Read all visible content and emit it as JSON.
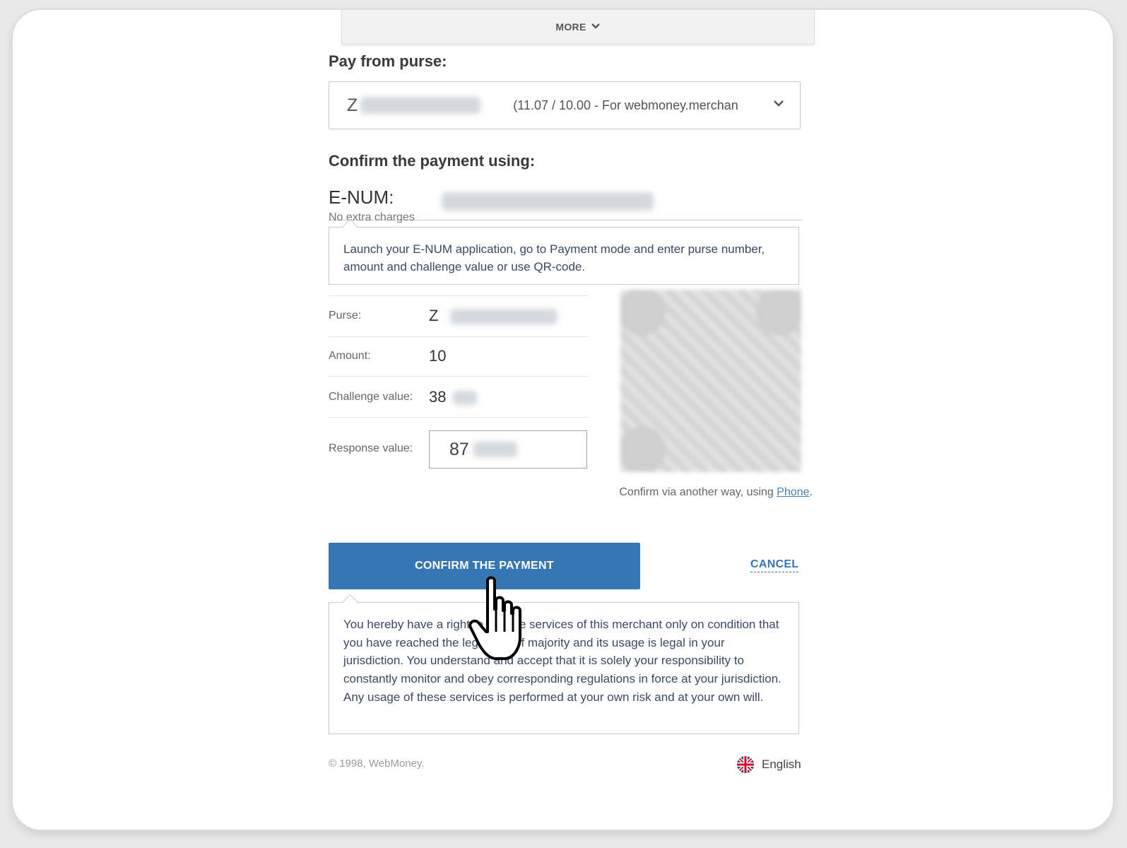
{
  "header": {
    "more_label": "MORE",
    "more_icon": "chevron-down-icon"
  },
  "pay_from": {
    "label": "Pay from purse:",
    "purse_prefix": "Z",
    "purse_info": "(11.07 / 10.00 - For webmoney.merchan"
  },
  "confirm": {
    "label": "Confirm the payment using:",
    "method_label": "E-NUM:",
    "no_charges": "No extra charges",
    "hint": "Launch your E-NUM application, go to Payment mode and enter purse number, amount and challenge value or use QR-code."
  },
  "details": {
    "purse_label": "Purse:",
    "purse_value": "Z",
    "amount_label": "Amount:",
    "amount_value": "10",
    "challenge_label": "Challenge value:",
    "challenge_value": "38",
    "response_label": "Response value:",
    "response_value": "87"
  },
  "alt": {
    "text": "Confirm via another way, using",
    "link": "Phone",
    "suffix": "."
  },
  "actions": {
    "confirm_label": "CONFIRM THE PAYMENT",
    "cancel_label": "CANCEL"
  },
  "terms": "You hereby have a right to use the services of this merchant only on condition that you have reached the legal age of majority and its usage is legal in your jurisdiction. You understand and accept that it is solely your responsibility to constantly monitor and obey corresponding regulations in force at your jurisdiction. Any usage of these services is performed at your own risk and at your own will.",
  "footer": {
    "copyright": "© 1998, WebMoney.",
    "language": "English",
    "language_icon": "uk-flag-icon"
  },
  "colors": {
    "primary": "#3776b5",
    "link": "#4a7fb5",
    "text_dark": "#3a4a63"
  }
}
